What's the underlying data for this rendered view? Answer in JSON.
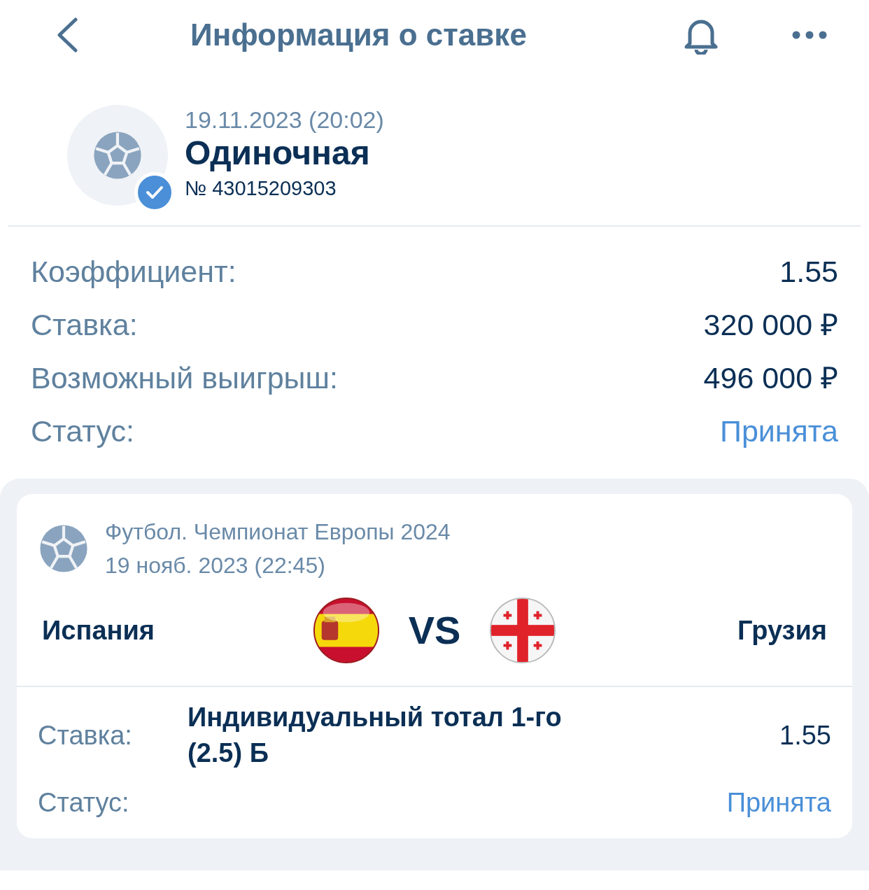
{
  "header": {
    "title": "Информация о ставке"
  },
  "bet": {
    "date": "19.11.2023 (20:02)",
    "type": "Одиночная",
    "number": "№ 43015209303",
    "verified": true
  },
  "summary": [
    {
      "label": "Коэффициент:",
      "value": "1.55",
      "kind": "plain"
    },
    {
      "label": "Ставка:",
      "value": "320 000 ₽",
      "kind": "plain"
    },
    {
      "label": "Возможный выигрыш:",
      "value": "496 000 ₽",
      "kind": "plain"
    },
    {
      "label": "Статус:",
      "value": "Принята",
      "kind": "status"
    }
  ],
  "event": {
    "league": "Футбол. Чемпионат Европы 2024",
    "datetime": "19 нояб. 2023 (22:45)",
    "home": "Испания",
    "versus": "VS",
    "away": "Грузия",
    "details": [
      {
        "kind": "market",
        "label": "Ставка:",
        "market": "Индивидуальный тотал 1-го (2.5) Б",
        "value": "1.55"
      },
      {
        "kind": "status",
        "label": "Статус:",
        "value": "Принята"
      }
    ]
  }
}
